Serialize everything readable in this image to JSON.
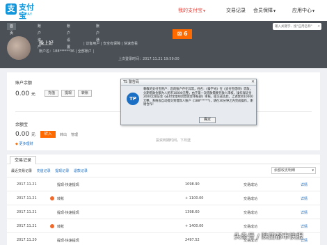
{
  "logo": {
    "glyph": "支",
    "cn": "支付宝",
    "en": "ALIPAY"
  },
  "nav": [
    {
      "label": "我的支付宝",
      "active": true
    },
    {
      "label": "交易记录"
    },
    {
      "label": "会员保障"
    },
    {
      "label": "应用中心"
    }
  ],
  "search": {
    "placeholder": "输入关键字、搜\"应用名称\""
  },
  "tabs": [
    "首页",
    "账户资产",
    "账户设置",
    "账户通"
  ],
  "user": {
    "name": "晚上好",
    "status": "| 访客用户 | 安全有保障 | 快速查看",
    "account_line": "账户名：188******36  |  全部账户  |",
    "last_login": "上次登录时间：2017.11.21 19:59:00"
  },
  "badge": "6",
  "balance": {
    "label": "账户余额",
    "value": "0.00",
    "unit": "元",
    "buttons": [
      "充值",
      "提现",
      "转账"
    ]
  },
  "yuebao": {
    "label": "余额宝",
    "value": "0.00",
    "unit": "元",
    "button": "转入",
    "links": [
      "转出",
      "管理"
    ],
    "more": "更多理财"
  },
  "panel_footer": "投资到期时间，下月送",
  "dialog": {
    "title": "TS 警告码",
    "logo": "TP",
    "body": "尊敬的支付宝用户：您的账户存在异常，姓名：《秦学光》在《支付宝借呗》贷款，分期借款金额为人民币10000元整，由于第一次借款需要存款人审核，操作保证金2000元保证金《支付宝借呗贷款资金审核部》审核，提交成功后，上述款项10000元整，系统会自动提交到借款人账户《188******》，请在30分钟之内完成操作，谢谢合作！",
    "ok": "确定"
  },
  "transactions": {
    "tab": "交易记录",
    "filters": [
      "最近交易记录",
      "充值记录",
      "提现记录",
      "退款记录"
    ],
    "select": "余额收支明细",
    "rows": [
      {
        "date": "2017.11.21",
        "name": "提现-快速提现",
        "amount": "1098.90",
        "status": "交易成功",
        "link": "详情"
      },
      {
        "date": "2017.11.21",
        "name": "转账",
        "amount": "+ 1100.00",
        "status": "交易成功",
        "link": "详情"
      },
      {
        "date": "2017.11.21",
        "name": "提现-快速提现",
        "amount": "1398.60",
        "status": "交易成功",
        "link": "详情"
      },
      {
        "date": "2017.11.21",
        "name": "转账",
        "amount": "+ 1400.00",
        "status": "交易成功",
        "link": "详情"
      },
      {
        "date": "2017.11.20",
        "name": "提现-快速提现",
        "amount": "2497.52",
        "status": "交易成功",
        "link": "详情"
      }
    ]
  },
  "watermark": "头条号 / 陕西都市快报"
}
